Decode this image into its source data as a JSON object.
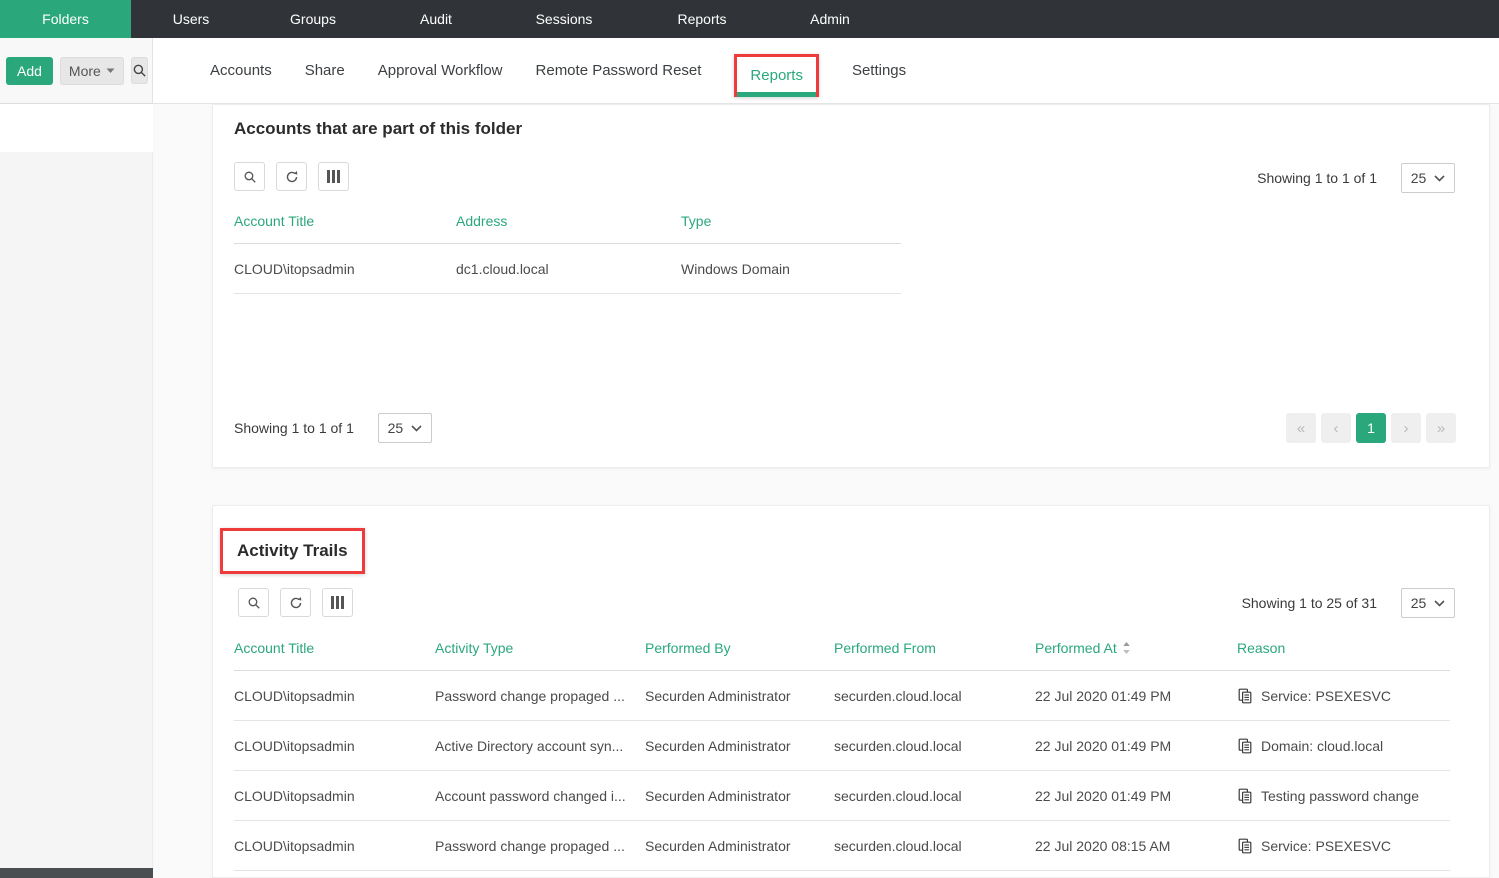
{
  "navbar": {
    "items": [
      "Folders",
      "Users",
      "Groups",
      "Audit",
      "Sessions",
      "Reports",
      "Admin"
    ],
    "active_item": "Folders"
  },
  "sidebar": {
    "add_label": "Add",
    "more_label": "More"
  },
  "folder_tabs": {
    "items": [
      "Accounts",
      "Share",
      "Approval Workflow",
      "Remote Password Reset",
      "Reports",
      "Settings"
    ],
    "active_item": "Reports"
  },
  "accounts_section": {
    "title": "Accounts that are part of this folder",
    "showing_text": "Showing 1 to 1 of 1",
    "page_size": "25",
    "columns": [
      "Account Title",
      "Address",
      "Type"
    ],
    "rows": [
      {
        "account_title": "CLOUD\\itopsadmin",
        "address": "dc1.cloud.local",
        "type": "Windows Domain"
      }
    ],
    "footer": {
      "showing_text": "Showing 1 to 1 of 1",
      "page_size": "25",
      "pagination": {
        "first": "«",
        "prev": "‹",
        "current_page": "1",
        "next": "›",
        "last": "»"
      }
    }
  },
  "activity_section": {
    "title": "Activity Trails",
    "showing_text": "Showing 1 to 25 of 31",
    "page_size": "25",
    "columns": [
      "Account Title",
      "Activity Type",
      "Performed By",
      "Performed From",
      "Performed At",
      "Reason"
    ],
    "rows": [
      {
        "account_title": "CLOUD\\itopsadmin",
        "activity_type": "Password change propaged ...",
        "performed_by": "Securden Administrator",
        "performed_from": "securden.cloud.local",
        "performed_at": "22 Jul 2020 01:49 PM",
        "reason": "Service: PSEXESVC"
      },
      {
        "account_title": "CLOUD\\itopsadmin",
        "activity_type": "Active Directory account syn...",
        "performed_by": "Securden Administrator",
        "performed_from": "securden.cloud.local",
        "performed_at": "22 Jul 2020 01:49 PM",
        "reason": "Domain: cloud.local"
      },
      {
        "account_title": "CLOUD\\itopsadmin",
        "activity_type": "Account password changed i...",
        "performed_by": "Securden Administrator",
        "performed_from": "securden.cloud.local",
        "performed_at": "22 Jul 2020 01:49 PM",
        "reason": "Testing password change"
      },
      {
        "account_title": "CLOUD\\itopsadmin",
        "activity_type": "Password change propaged ...",
        "performed_by": "Securden Administrator",
        "performed_from": "securden.cloud.local",
        "performed_at": "22 Jul 2020 08:15 AM",
        "reason": "Service: PSEXESVC"
      }
    ]
  },
  "colors": {
    "accent_green": "#2aa87b",
    "annotation_red": "#ee3b3b",
    "navbar_bg": "#303438"
  }
}
